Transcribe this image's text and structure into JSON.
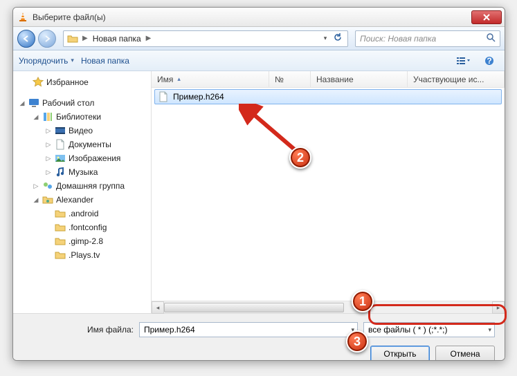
{
  "window": {
    "title": "Выберите файл(ы)"
  },
  "nav": {
    "breadcrumb_item": "Новая папка",
    "search_placeholder": "Поиск: Новая папка"
  },
  "toolbar": {
    "organize": "Упорядочить",
    "new_folder": "Новая папка"
  },
  "columns": {
    "name": "Имя",
    "number": "№",
    "title": "Название",
    "contributing": "Участвующие ис..."
  },
  "sidebar": {
    "favorites": "Избранное",
    "desktop": "Рабочий стол",
    "libraries": "Библиотеки",
    "videos": "Видео",
    "documents": "Документы",
    "pictures": "Изображения",
    "music": "Музыка",
    "homegroup": "Домашняя группа",
    "user": "Alexander",
    "folders": {
      "f0": ".android",
      "f1": ".fontconfig",
      "f2": ".gimp-2.8",
      "f3": ".Plays.tv"
    }
  },
  "files": {
    "item0": "Пример.h264"
  },
  "footer": {
    "filename_label": "Имя файла:",
    "filename_value": "Пример.h264",
    "filter_value": "все файлы ( * ) (;*.*;)",
    "open": "Открыть",
    "cancel": "Отмена"
  },
  "annotations": {
    "b1": "1",
    "b2": "2",
    "b3": "3"
  }
}
